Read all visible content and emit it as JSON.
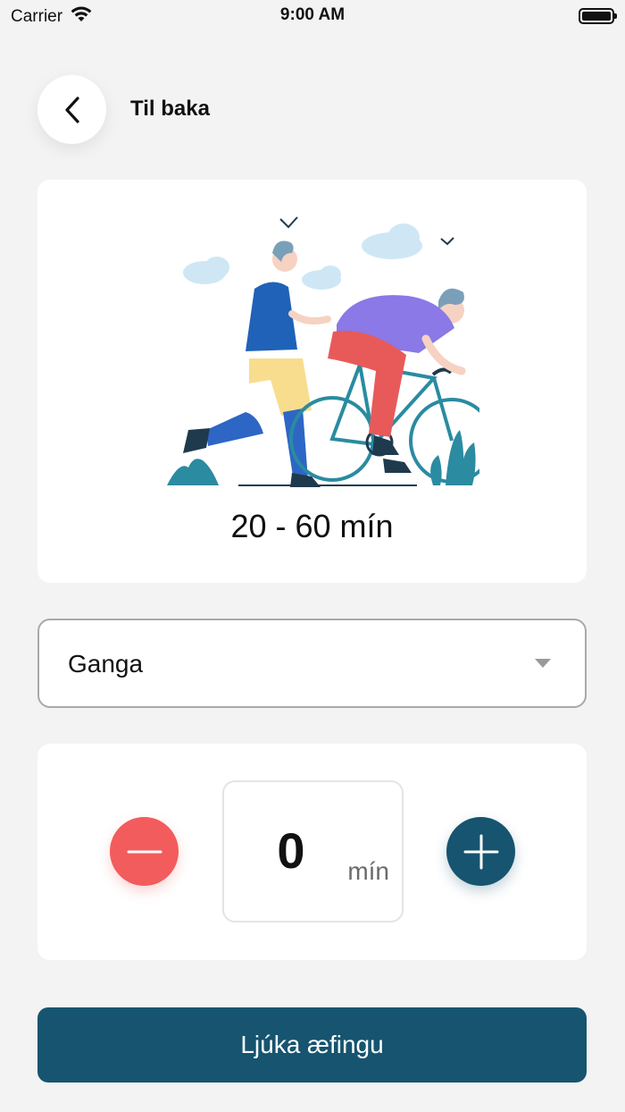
{
  "status_bar": {
    "carrier": "Carrier",
    "time": "9:00 AM",
    "battery_icon": "battery-full-icon",
    "wifi_icon": "wifi-icon"
  },
  "header": {
    "back_icon": "chevron-left-icon",
    "back_label": "Til baka"
  },
  "hero": {
    "illustration": "runner-and-cyclist-illustration",
    "duration": "20 - 60 mín"
  },
  "activity_select": {
    "value": "Ganga",
    "caret_icon": "caret-down-icon"
  },
  "stepper": {
    "value": "0",
    "unit": "mín",
    "minus_icon": "minus-icon",
    "plus_icon": "plus-icon"
  },
  "actions": {
    "finish_label": "Ljúka æfingu"
  },
  "colors": {
    "background": "#f3f3f3",
    "primary": "#16546f",
    "minus": "#f25c5c"
  }
}
